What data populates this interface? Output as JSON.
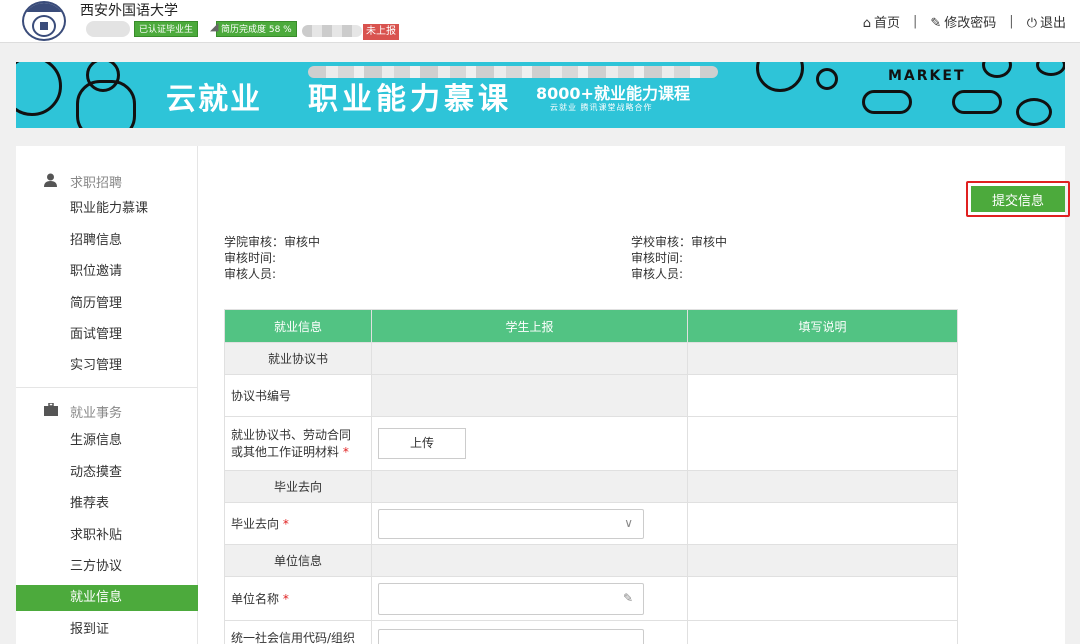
{
  "header": {
    "school_name": "西安外国语大学",
    "badge_graduate": "已认证毕业生",
    "badge_resume": "简历完成度 58 %",
    "nav": {
      "home": "首页",
      "change_password": "修改密码",
      "logout": "退出",
      "separator": "|"
    }
  },
  "banner": {
    "brand": "云就业",
    "title": "职业能力慕课",
    "subtitle": "8000+就业能力课程",
    "subtitle_small": "云就业 腾讯课堂战略合作",
    "market": "MARKET"
  },
  "sidebar": {
    "group1": "求职招聘",
    "group1_items": [
      "职业能力慕课",
      "招聘信息",
      "职位邀请",
      "简历管理",
      "面试管理",
      "实习管理"
    ],
    "group2": "就业事务",
    "group2_items": [
      "生源信息",
      "动态摸查",
      "推荐表",
      "求职补贴",
      "三方协议",
      "就业信息",
      "报到证"
    ],
    "active_item": "就业信息"
  },
  "content": {
    "status_tag": "未上报",
    "college_review": "学院审核：审核中",
    "college_time": "审核时间:",
    "college_reviewer": "审核人员:",
    "school_review": "学校审核：审核中",
    "school_time": "审核时间:",
    "school_reviewer": "审核人员:",
    "submit_button": "提交信息"
  },
  "table": {
    "headers": [
      "就业信息",
      "学生上报",
      "填写说明"
    ],
    "section_agreement": "就业协议书",
    "row_agreement_no": "协议书编号",
    "row_materials_line1": "就业协议书、劳动合同",
    "row_materials_line2": "或其他工作证明材料",
    "upload_label": "上传",
    "section_destination": "毕业去向",
    "row_destination": "毕业去向",
    "section_unit": "单位信息",
    "row_unit_name": "单位名称",
    "row_credit_code": "统一社会信用代码/组织",
    "required_mark": "*"
  },
  "colors": {
    "green": "#4caa3c",
    "table_header": "#52c383",
    "banner_bg": "#2ec4d8",
    "highlight": "#e02020"
  }
}
